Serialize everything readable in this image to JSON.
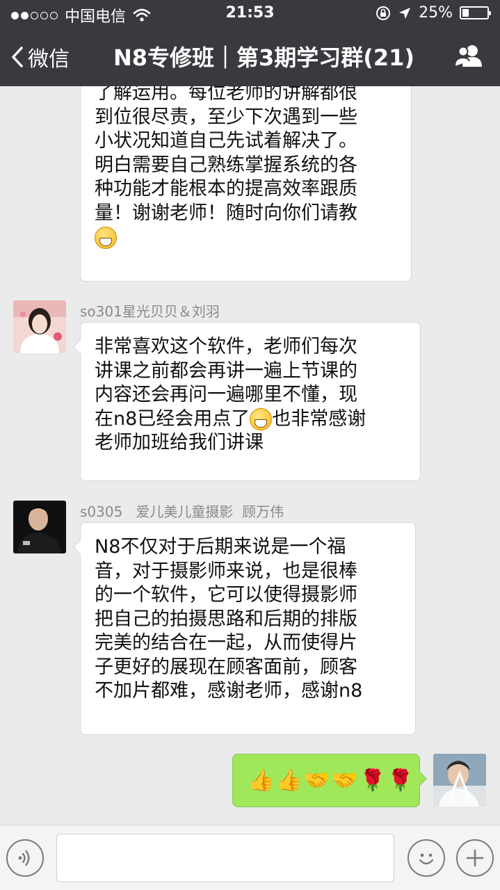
{
  "status_bar": {
    "carrier": "中国电信",
    "time": "21:53",
    "battery_percent": "25%",
    "battery_level": 0.25,
    "signal_dots_filled": 2,
    "signal_dots_total": 5
  },
  "nav": {
    "back_label": "微信",
    "title": "N8专修班｜第3期学习群(21)"
  },
  "messages": [
    {
      "sender": "",
      "lines": [
        "了解运用。每位老师的讲解都很",
        "到位很尽责，至少下次遇到一些",
        "小状况知道自己先试着解决了。",
        "明白需要自己熟练掌握系统的各",
        "种功能才能根本的提高效率跟质",
        "量！谢谢老师！随时向你们请教"
      ],
      "trailing_emoji": "grin-emoji"
    },
    {
      "sender": "so301星光贝贝＆刘羽",
      "lines": [
        "非常喜欢这个软件，老师们每次",
        "讲课之前都会再讲一遍上节课的",
        "内容还会再问一遍哪里不懂，现"
      ],
      "line4_before": "在n8已经会用点了",
      "line4_after": "也非常感谢",
      "line5": "老师加班给我们讲课"
    },
    {
      "sender": "s0305   爱儿美儿童摄影  顾万伟",
      "lines": [
        "N8不仅对于后期来说是一个福",
        "音，对于摄影师来说，也是很棒",
        "的一个软件，它可以使得摄影师",
        "把自己的拍摄思路和后期的排版",
        "完美的结合在一起，从而使得片",
        "子更好的展现在顾客面前，顾客",
        "不加片都难，感谢老师，感谢n8"
      ]
    },
    {
      "sender": "me",
      "emojis": [
        "👍",
        "👍",
        "🤝",
        "🤝",
        "🌹",
        "🌹"
      ]
    }
  ],
  "icons": {
    "wifi": "wifi-icon",
    "lock": "rotation-lock-icon",
    "location": "location-arrow-icon",
    "group": "group-members-icon",
    "voice": "voice-icon",
    "emoji": "emoji-icon",
    "plus": "plus-icon"
  },
  "colors": {
    "nav_bg": "#393a3f",
    "chat_bg": "#ebebeb",
    "sent_bubble": "#a0e75a"
  }
}
